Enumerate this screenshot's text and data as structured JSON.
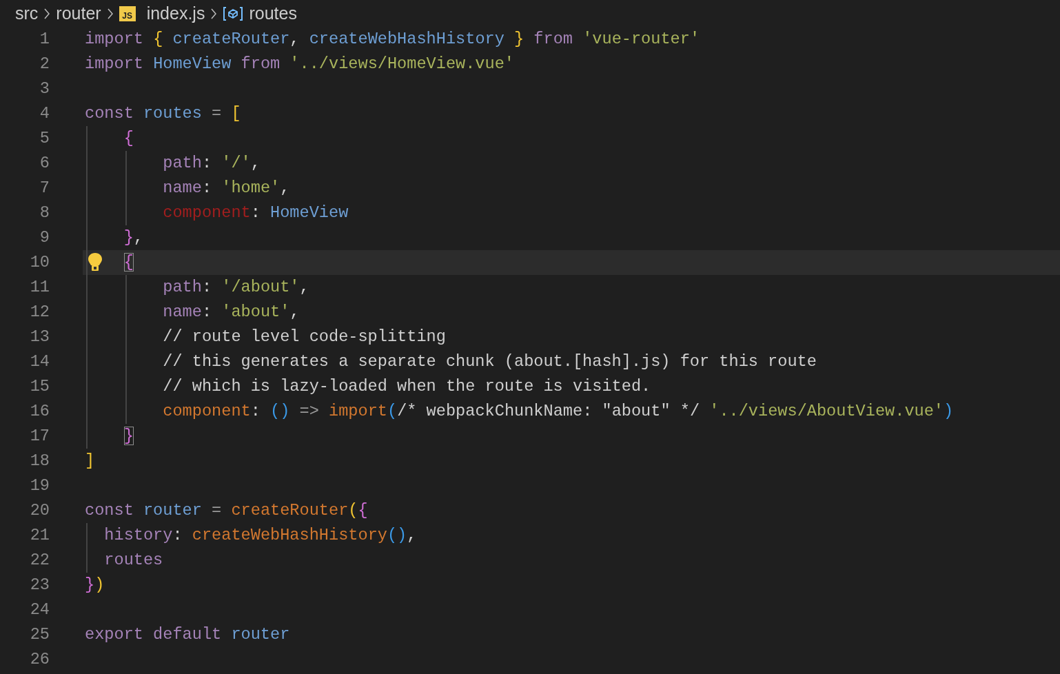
{
  "breadcrumb": [
    {
      "kind": "folder",
      "label": "src"
    },
    {
      "kind": "folder",
      "label": "router"
    },
    {
      "kind": "file",
      "icon_text": "JS",
      "label": "index.js"
    },
    {
      "kind": "symbol",
      "label": "routes"
    }
  ],
  "lines": [
    {
      "number": "1",
      "tokens": [
        {
          "kind": "keyword",
          "text": "import "
        },
        {
          "kind": "brace",
          "text": "{"
        },
        {
          "kind": "ident",
          "text": " createRouter"
        },
        {
          "kind": "punct",
          "text": ", "
        },
        {
          "kind": "ident",
          "text": "createWebHashHistory "
        },
        {
          "kind": "brace",
          "text": "}"
        },
        {
          "kind": "keyword",
          "text": " from "
        },
        {
          "kind": "string",
          "text": "'vue-router'"
        }
      ]
    },
    {
      "number": "2",
      "tokens": [
        {
          "kind": "keyword",
          "text": "import "
        },
        {
          "kind": "ident",
          "text": "HomeView "
        },
        {
          "kind": "keyword",
          "text": "from "
        },
        {
          "kind": "string",
          "text": "'../views/HomeView.vue'"
        }
      ]
    },
    {
      "number": "3"
    },
    {
      "number": "4",
      "tokens": [
        {
          "kind": "keyword",
          "text": "const "
        },
        {
          "kind": "ident",
          "text": "routes "
        },
        {
          "kind": "operator",
          "text": "= "
        },
        {
          "kind": "brace",
          "text": "["
        }
      ]
    },
    {
      "number": "5",
      "tokens": [
        {
          "kind": "brace2",
          "text": "    {"
        }
      ]
    },
    {
      "number": "6",
      "tokens": [
        {
          "kind": "property",
          "text": "        path"
        },
        {
          "kind": "punct",
          "text": ": "
        },
        {
          "kind": "string",
          "text": "'/'"
        },
        {
          "kind": "punct",
          "text": ","
        }
      ]
    },
    {
      "number": "7",
      "tokens": [
        {
          "kind": "property",
          "text": "        name"
        },
        {
          "kind": "punct",
          "text": ": "
        },
        {
          "kind": "string",
          "text": "'home'"
        },
        {
          "kind": "punct",
          "text": ","
        }
      ]
    },
    {
      "number": "8",
      "tokens": [
        {
          "kind": "error",
          "text": "        component"
        },
        {
          "kind": "punct",
          "text": ": "
        },
        {
          "kind": "ident",
          "text": "HomeView"
        }
      ]
    },
    {
      "number": "9",
      "tokens": [
        {
          "kind": "brace2",
          "text": "    }"
        },
        {
          "kind": "punct",
          "text": ","
        }
      ]
    },
    {
      "number": "10",
      "current": true,
      "lightbulb": true,
      "bracket_highlight": true,
      "tokens": [
        {
          "kind": "brace2",
          "text": "    {"
        }
      ]
    },
    {
      "number": "11",
      "tokens": [
        {
          "kind": "property",
          "text": "        path"
        },
        {
          "kind": "punct",
          "text": ": "
        },
        {
          "kind": "string",
          "text": "'/about'"
        },
        {
          "kind": "punct",
          "text": ","
        }
      ]
    },
    {
      "number": "12",
      "tokens": [
        {
          "kind": "property",
          "text": "        name"
        },
        {
          "kind": "punct",
          "text": ": "
        },
        {
          "kind": "string",
          "text": "'about'"
        },
        {
          "kind": "punct",
          "text": ","
        }
      ]
    },
    {
      "number": "13",
      "tokens": [
        {
          "kind": "comment",
          "text": "        // route level code-splitting"
        }
      ]
    },
    {
      "number": "14",
      "tokens": [
        {
          "kind": "comment",
          "text": "        // this generates a separate chunk (about.[hash].js) for this route"
        }
      ]
    },
    {
      "number": "15",
      "tokens": [
        {
          "kind": "comment",
          "text": "        // which is lazy-loaded when the route is visited."
        }
      ]
    },
    {
      "number": "16",
      "tokens": [
        {
          "kind": "func",
          "text": "        component"
        },
        {
          "kind": "punct",
          "text": ": "
        },
        {
          "kind": "paren",
          "text": "()"
        },
        {
          "kind": "operator",
          "text": " => "
        },
        {
          "kind": "func",
          "text": "import"
        },
        {
          "kind": "paren",
          "text": "("
        },
        {
          "kind": "comment",
          "text": "/* webpackChunkName: \"about\" */ "
        },
        {
          "kind": "string",
          "text": "'../views/AboutView.vue'"
        },
        {
          "kind": "paren",
          "text": ")"
        }
      ]
    },
    {
      "number": "17",
      "bracket_highlight": true,
      "tokens": [
        {
          "kind": "brace2",
          "text": "    }"
        }
      ]
    },
    {
      "number": "18",
      "tokens": [
        {
          "kind": "brace",
          "text": "]"
        }
      ]
    },
    {
      "number": "19"
    },
    {
      "number": "20",
      "tokens": [
        {
          "kind": "keyword",
          "text": "const "
        },
        {
          "kind": "ident",
          "text": "router "
        },
        {
          "kind": "operator",
          "text": "= "
        },
        {
          "kind": "func",
          "text": "createRouter"
        },
        {
          "kind": "brace",
          "text": "("
        },
        {
          "kind": "brace2",
          "text": "{"
        }
      ]
    },
    {
      "number": "21",
      "tokens": [
        {
          "kind": "property",
          "text": "  history"
        },
        {
          "kind": "punct",
          "text": ": "
        },
        {
          "kind": "func",
          "text": "createWebHashHistory"
        },
        {
          "kind": "paren",
          "text": "()"
        },
        {
          "kind": "punct",
          "text": ","
        }
      ]
    },
    {
      "number": "22",
      "tokens": [
        {
          "kind": "property",
          "text": "  routes"
        }
      ]
    },
    {
      "number": "23",
      "tokens": [
        {
          "kind": "brace2",
          "text": "}"
        },
        {
          "kind": "brace",
          "text": ")"
        }
      ]
    },
    {
      "number": "24"
    },
    {
      "number": "25",
      "tokens": [
        {
          "kind": "keyword",
          "text": "export default "
        },
        {
          "kind": "ident",
          "text": "router"
        }
      ]
    },
    {
      "number": "26"
    }
  ]
}
